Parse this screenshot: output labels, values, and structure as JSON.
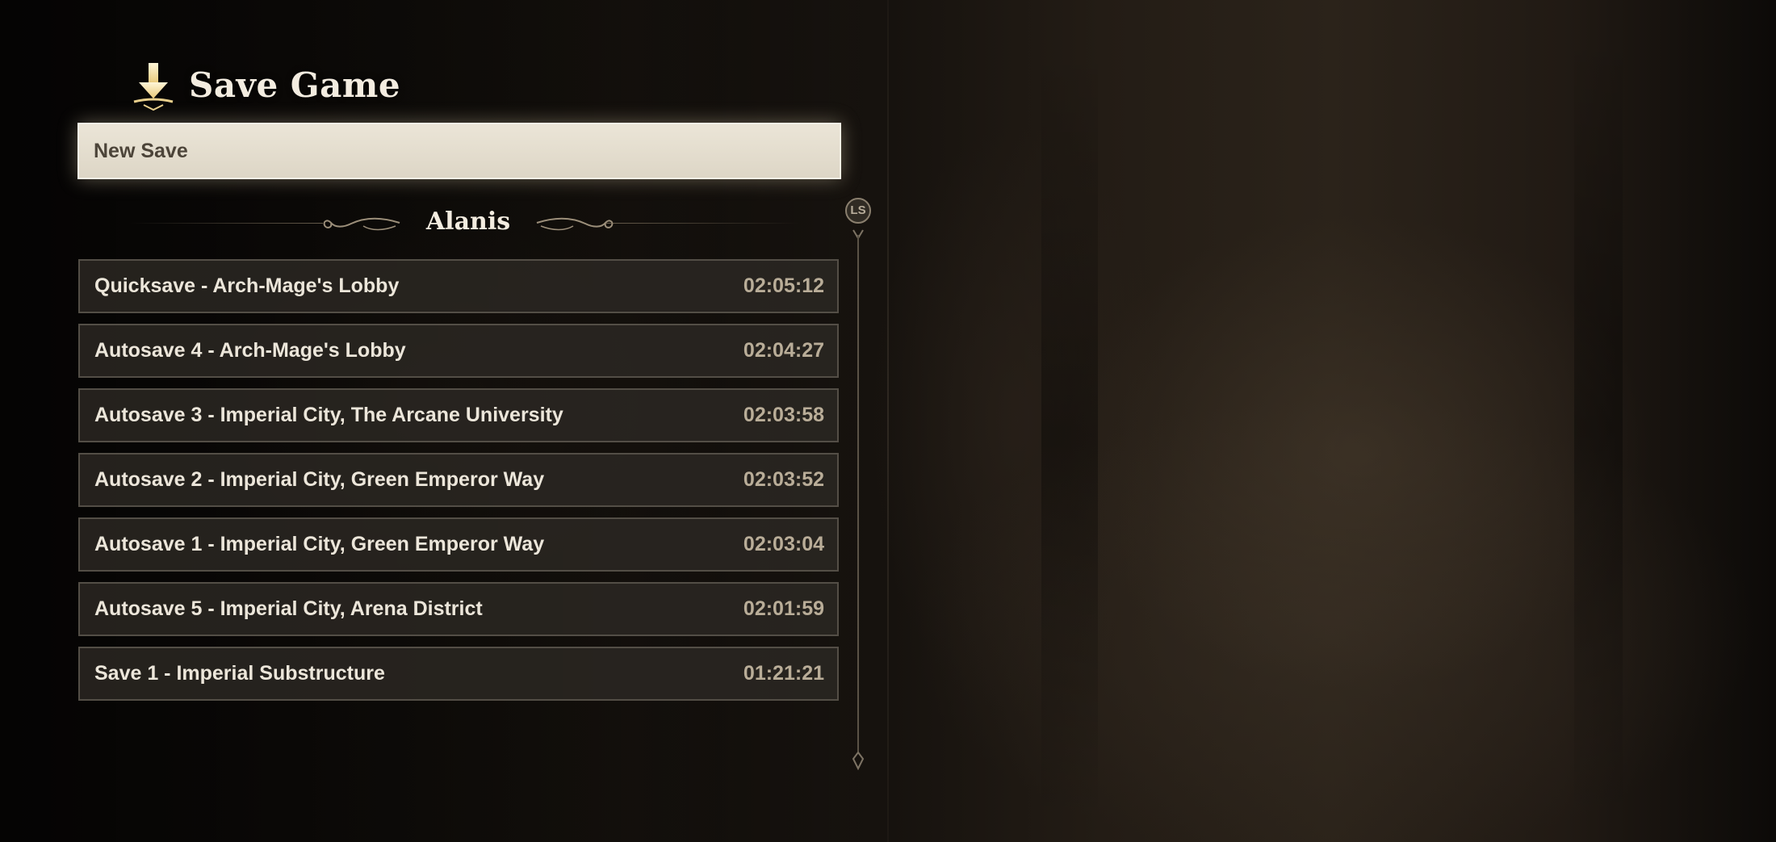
{
  "header": {
    "title": "Save Game",
    "icon": "save-arrow-icon"
  },
  "new_save": {
    "label": "New Save"
  },
  "group": {
    "title": "Alanis"
  },
  "saves": [
    {
      "name": "Quicksave - Arch-Mage's Lobby",
      "time": "02:05:12"
    },
    {
      "name": "Autosave 4 - Arch-Mage's Lobby",
      "time": "02:04:27"
    },
    {
      "name": "Autosave 3 - Imperial City, The Arcane University",
      "time": "02:03:58"
    },
    {
      "name": "Autosave 2 - Imperial City, Green Emperor Way",
      "time": "02:03:52"
    },
    {
      "name": "Autosave 1 - Imperial City, Green Emperor Way",
      "time": "02:03:04"
    },
    {
      "name": "Autosave 5 - Imperial City, Arena District",
      "time": "02:01:59"
    },
    {
      "name": "Save 1 - Imperial Substructure",
      "time": "01:21:21"
    }
  ],
  "scroll": {
    "button_label": "LS"
  },
  "colors": {
    "highlight": "#ebe5d7",
    "row_bg": "#2c2823",
    "text_primary": "#ece6da",
    "text_time": "#b9ad98"
  }
}
